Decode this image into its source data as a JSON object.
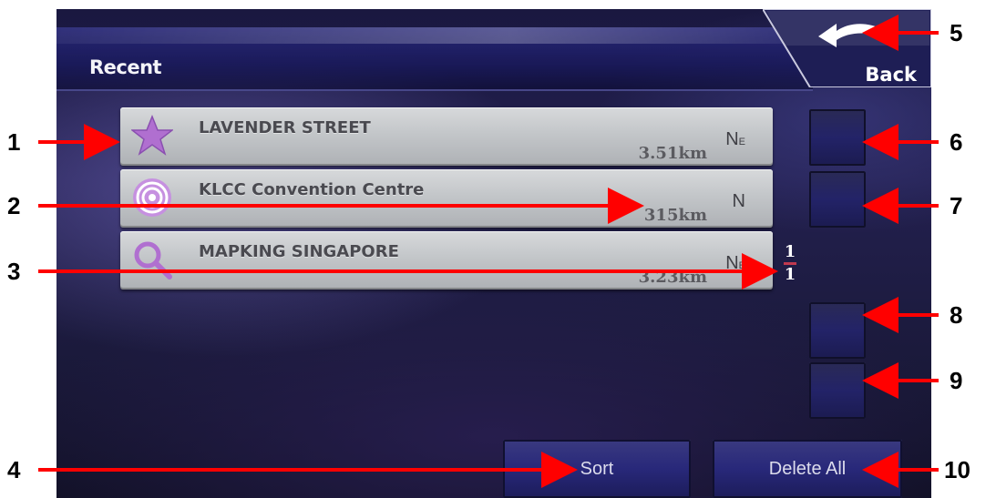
{
  "header": {
    "title": "Recent",
    "back_label": "Back"
  },
  "list": {
    "items": [
      {
        "name": "LAVENDER STREET",
        "distance": "3.51km",
        "direction": "N",
        "direction_sub": "E",
        "icon": "star-icon"
      },
      {
        "name": "KLCC Convention Centre",
        "distance": "315km",
        "direction": "N",
        "direction_sub": "",
        "icon": "poi-target-icon"
      },
      {
        "name": "MAPKING SINGAPORE",
        "distance": "3.23km",
        "direction": "N",
        "direction_sub": "E",
        "icon": "search-icon"
      }
    ]
  },
  "pager": {
    "current": "1",
    "total": "1"
  },
  "footer": {
    "sort_label": "Sort",
    "delete_all_label": "Delete All"
  },
  "callouts": [
    "1",
    "2",
    "3",
    "4",
    "5",
    "6",
    "7",
    "8",
    "9",
    "10"
  ],
  "colors": {
    "accent_arrow": "#ff0000",
    "row_bg": "#c3c6c9",
    "button_bg": "#232368",
    "pager_divider": "#c0394f",
    "icon_purple": "#b06fd0"
  }
}
